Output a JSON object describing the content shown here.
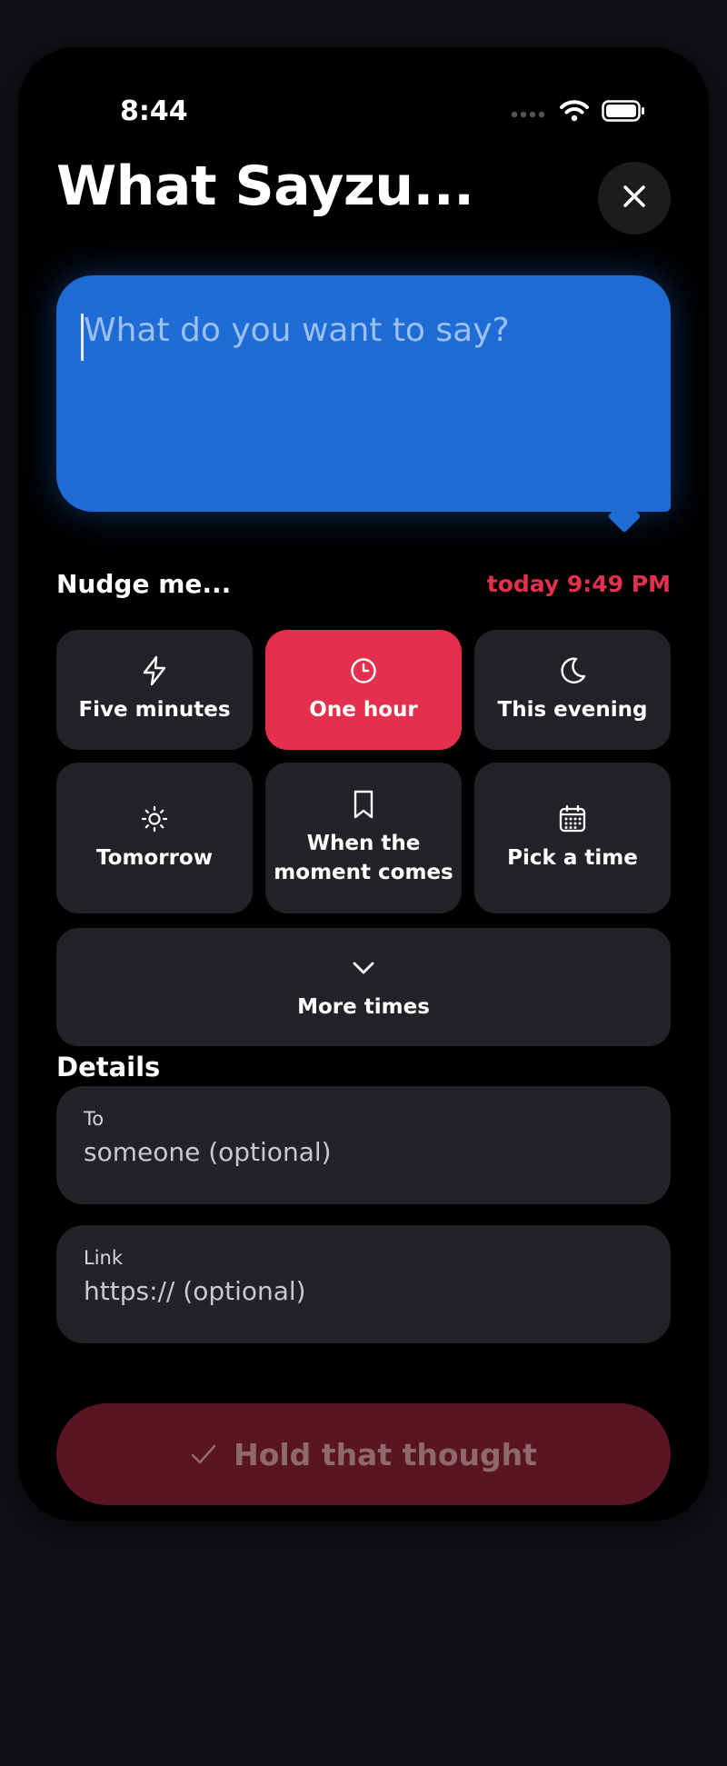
{
  "status_bar": {
    "time": "8:44"
  },
  "header": {
    "title": "What Sayzu..."
  },
  "message": {
    "placeholder": "What do you want to say?"
  },
  "nudge": {
    "label": "Nudge me...",
    "scheduled_time": "today 9:49 PM",
    "options": [
      {
        "label": "Five minutes",
        "icon": "lightning-icon",
        "selected": false
      },
      {
        "label": "One hour",
        "icon": "clock-icon",
        "selected": true
      },
      {
        "label": "This evening",
        "icon": "moon-icon",
        "selected": false
      },
      {
        "label": "Tomorrow",
        "icon": "sun-icon",
        "selected": false
      },
      {
        "label": "When the\nmoment comes",
        "icon": "bookmark-icon",
        "selected": false
      },
      {
        "label": "Pick a time",
        "icon": "calendar-icon",
        "selected": false
      }
    ],
    "more_label": "More times"
  },
  "details": {
    "label": "Details",
    "to": {
      "label": "To",
      "placeholder": "someone (optional)"
    },
    "link": {
      "label": "Link",
      "placeholder": "https:// (optional)"
    }
  },
  "submit": {
    "label": "Hold that thought"
  },
  "colors": {
    "accent_red": "#e5304d",
    "bubble_blue": "#1f6cd6",
    "tile_bg": "#232327",
    "submit_disabled": "#5a1620"
  }
}
